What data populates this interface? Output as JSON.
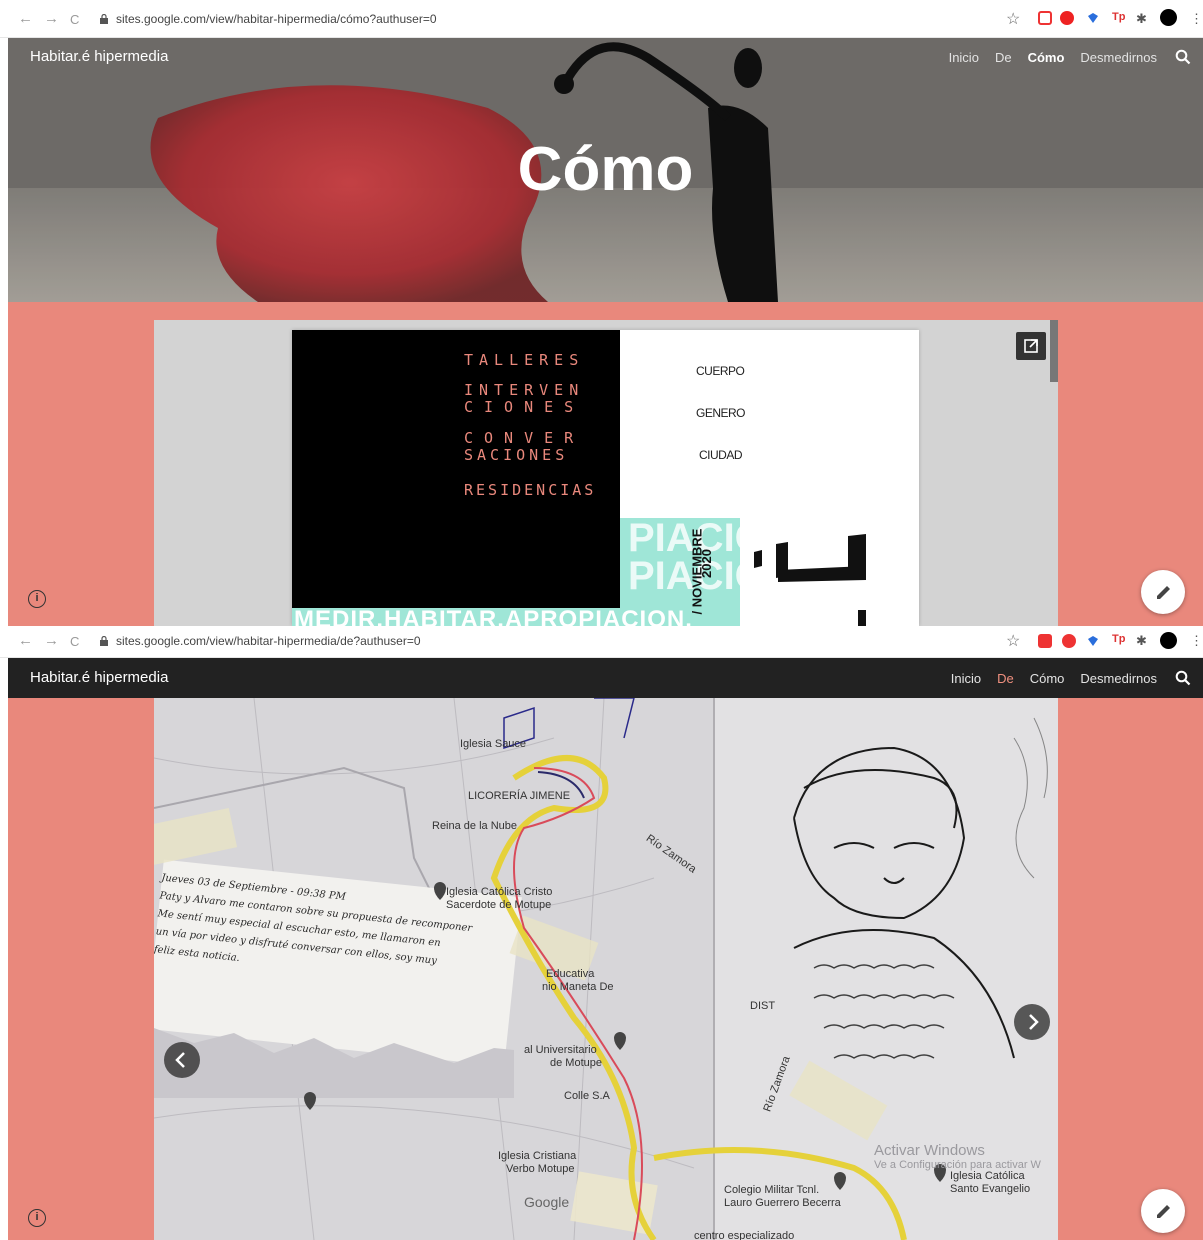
{
  "shot1": {
    "browser": {
      "address": "sites.google.com/view/habitar-hipermedia/cómo?authuser=0",
      "nav_back": "←",
      "nav_forward": "→",
      "nav_reload": "C",
      "star": "☆"
    },
    "site_title": "Habitar.é hipermedia",
    "menu": [
      "Inicio",
      "De",
      "Cómo",
      "Desmedirnos"
    ],
    "active_menu_index": 2,
    "hero_title": "Cómo",
    "embed": {
      "left_items": [
        "TALLERES",
        "INTERVEN",
        "CIONES",
        "CONVER",
        "SACIONES",
        "RESIDENCIAS"
      ],
      "right_items": [
        "CUERPO",
        "GENERO",
        "CIUDAD"
      ],
      "date_line1": "/ NOVIEMBRE",
      "date_line2": "2020",
      "band_text": "PIACION.",
      "bottom_text": "MEDIR.HABITAR.APROPIACION."
    },
    "info_icon": "i"
  },
  "shot2": {
    "browser": {
      "address": "sites.google.com/view/habitar-hipermedia/de?authuser=0",
      "nav_back": "←",
      "nav_forward": "→",
      "nav_reload": "C",
      "star": "☆"
    },
    "site_title": "Habitar.é hipermedia",
    "menu": [
      "Inicio",
      "De",
      "Cómo",
      "Desmedirnos"
    ],
    "active_menu_index": 1,
    "map_labels": [
      "Iglesia Sauce",
      "LICORERÍA JIMENE",
      "Reina de la Nube",
      "Río Zamora",
      "Iglesia Católica Cristo",
      "Sacerdote de Motupe",
      "Educativa",
      "nio Maneta De",
      "DIST",
      "al Universitario",
      "de Motupe",
      "Colle S.A",
      "Iglesia Cristiana",
      "Verbo Motupe",
      "Colegio Militar Tcnl.",
      "Lauro Guerrero Becerra",
      "Iglesia Católica",
      "Santo Evangelio",
      "Río Zamora",
      "Google",
      "centro especializado"
    ],
    "note_lines": [
      "Jueves 03 de Septiembre - 09:38 PM",
      "Paty y Alvaro me contaron sobre su propuesta de recomponer",
      "Me sentí muy especial al escuchar esto, me llamaron en",
      "un vía por video y disfruté conversar con ellos, soy muy",
      "feliz esta noticia."
    ],
    "watermark_line1": "Activar Windows",
    "watermark_line2": "Ve a Configuración para activar W",
    "info_icon": "i"
  },
  "colors": {
    "salmon": "#e9887c",
    "dark_header": "#222222",
    "active_menu": "#f0907f",
    "hero_red": "#c43a3e",
    "talleres_text": "#e9887c",
    "mint": "#9fe6d7"
  }
}
